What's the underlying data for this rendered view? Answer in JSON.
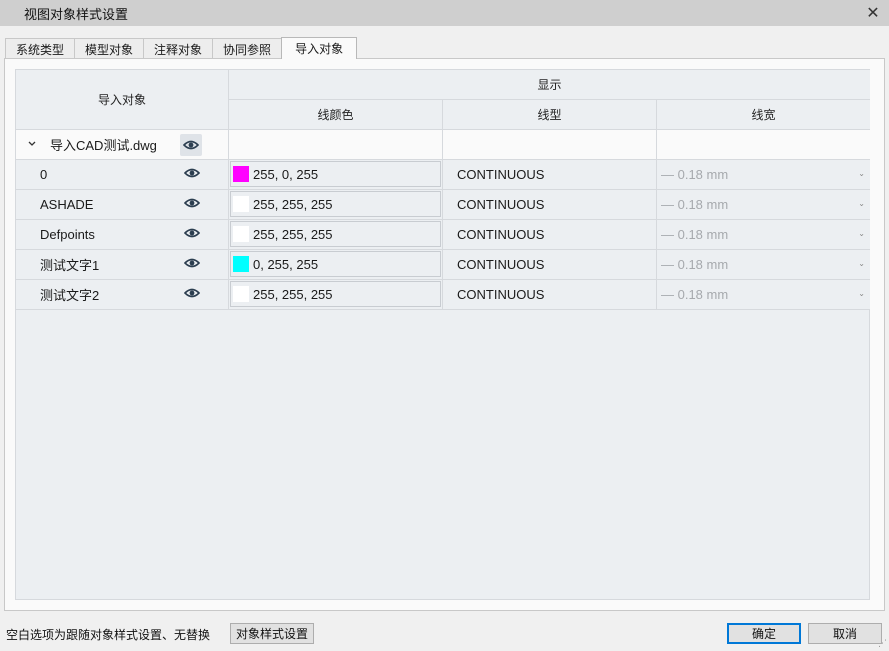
{
  "window": {
    "title": "视图对象样式设置",
    "close_icon": "close-icon"
  },
  "tabs": [
    {
      "label": "系统类型"
    },
    {
      "label": "模型对象"
    },
    {
      "label": "注释对象"
    },
    {
      "label": "协同参照"
    },
    {
      "label": "导入对象",
      "active": true
    }
  ],
  "table": {
    "col_object": "导入对象",
    "col_display": "显示",
    "col_color": "线颜色",
    "col_linetype": "线型",
    "col_lineweight": "线宽",
    "group": {
      "name": "导入CAD测试.dwg",
      "expanded": true
    },
    "rows": [
      {
        "name": "0",
        "color": "255, 0, 255",
        "color_hex": "#ff00ff",
        "linetype": "CONTINUOUS",
        "lineweight": "— 0.18 mm"
      },
      {
        "name": "ASHADE",
        "color": "255, 255, 255",
        "color_hex": "#ffffff",
        "linetype": "CONTINUOUS",
        "lineweight": "— 0.18 mm"
      },
      {
        "name": "Defpoints",
        "color": "255, 255, 255",
        "color_hex": "#ffffff",
        "linetype": "CONTINUOUS",
        "lineweight": "— 0.18 mm"
      },
      {
        "name": "测试文字1",
        "color": "0, 255, 255",
        "color_hex": "#00ffff",
        "linetype": "CONTINUOUS",
        "lineweight": "— 0.18 mm"
      },
      {
        "name": "测试文字2",
        "color": "255, 255, 255",
        "color_hex": "#ffffff",
        "linetype": "CONTINUOUS",
        "lineweight": "— 0.18 mm"
      }
    ]
  },
  "footer": {
    "note": "空白选项为跟随对象样式设置、无替换",
    "object_style_button": "对象样式设置",
    "ok_button": "确定",
    "cancel_button": "取消"
  },
  "colors": {
    "accent": "#0078d7",
    "swatch_magenta": "#ff00ff",
    "swatch_cyan": "#00ffff",
    "swatch_white": "#ffffff"
  }
}
